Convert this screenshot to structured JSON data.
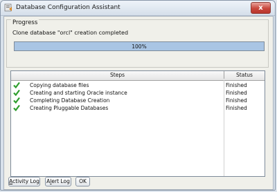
{
  "window": {
    "title": "Database Configuration Assistant",
    "close_glyph": "x"
  },
  "progress": {
    "group_label": "Progress",
    "status_text": "Clone database \"orcl\" creation completed",
    "percent": 100,
    "percent_label": "100%"
  },
  "steps": {
    "headers": {
      "steps": "Steps",
      "status": "Status"
    },
    "rows": [
      {
        "label": "Copying database files",
        "status": "Finished"
      },
      {
        "label": "Creating and starting Oracle instance",
        "status": "Finished"
      },
      {
        "label": "Completing Database Creation",
        "status": "Finished"
      },
      {
        "label": "Creating Pluggable Databases",
        "status": "Finished"
      }
    ],
    "check_icon": "green-checkmark"
  },
  "buttons": {
    "activity_log": {
      "mnemonic": "A",
      "rest": "ctivity Log"
    },
    "alert_log": {
      "pre": "A",
      "mnemonic": "l",
      "rest": "ert Log"
    },
    "ok": "OK"
  },
  "colors": {
    "progress_fill": "#a9c5e4",
    "check_green": "#2e9e2e",
    "close_red": "#c8473c"
  }
}
